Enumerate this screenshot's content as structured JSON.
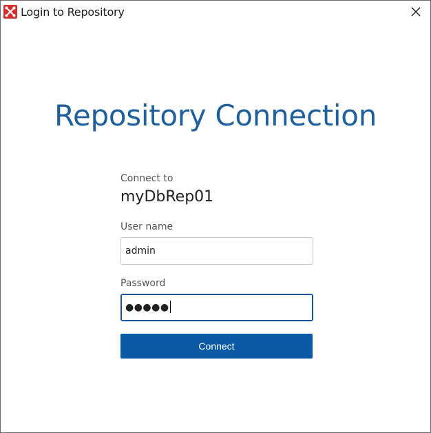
{
  "window": {
    "title": "Login to Repository",
    "app_icon": "repository-app-icon",
    "close_icon": "close-icon"
  },
  "main": {
    "heading": "Repository Connection",
    "connect_to_label": "Connect to",
    "connect_to_value": "myDbRep01",
    "username_label": "User name",
    "username_value": "admin",
    "password_label": "Password",
    "password_masked": "●●●●●",
    "connect_button_label": "Connect"
  },
  "colors": {
    "heading": "#1f5f9c",
    "button": "#0b5aa6",
    "focus_border": "#1a5496",
    "app_icon_bg": "#d32f2f"
  }
}
